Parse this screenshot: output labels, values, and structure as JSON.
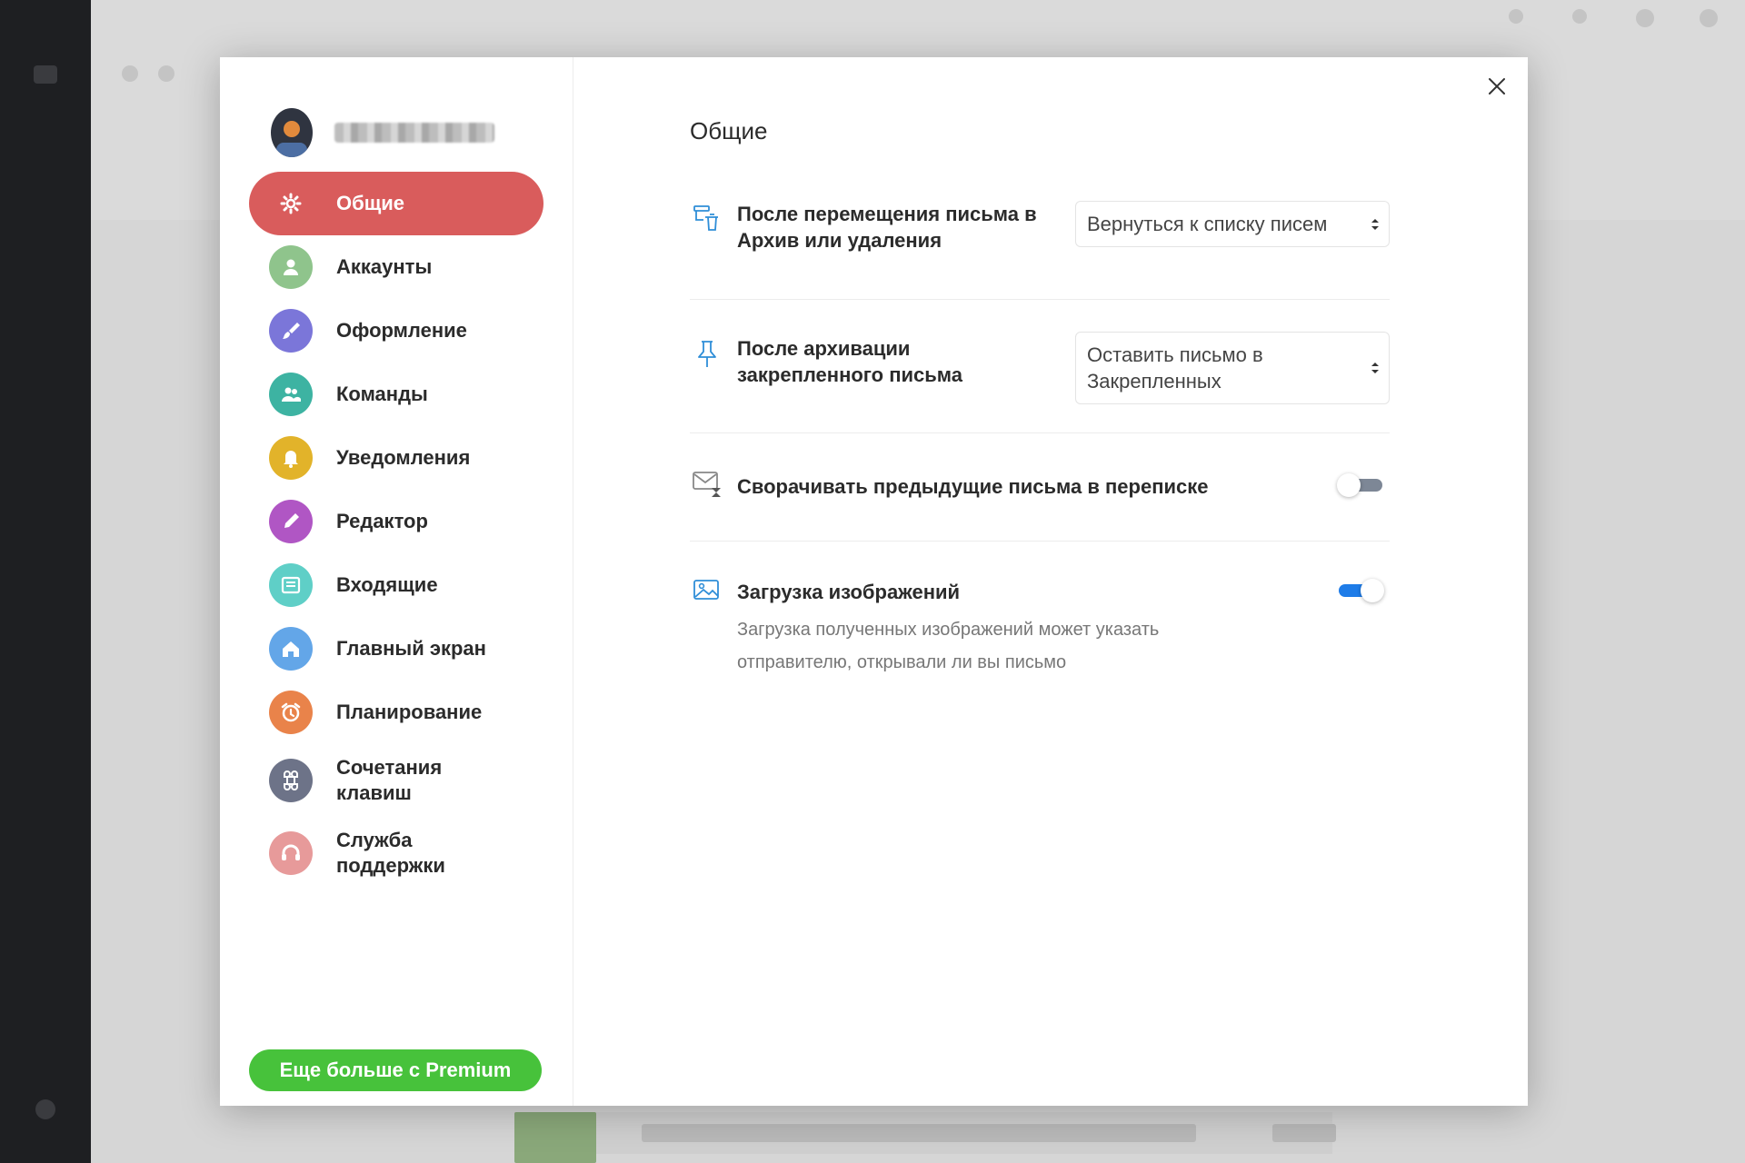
{
  "sidebar": {
    "items": [
      {
        "label": "Общие",
        "icon": "gear-icon",
        "color": "#d95c5c",
        "active": true
      },
      {
        "label": "Аккаунты",
        "icon": "user-icon",
        "color": "#8fc48c"
      },
      {
        "label": "Оформление",
        "icon": "brush-icon",
        "color": "#7b76d9"
      },
      {
        "label": "Команды",
        "icon": "team-icon",
        "color": "#3db3a2"
      },
      {
        "label": "Уведомления",
        "icon": "bell-icon",
        "color": "#e2b32a"
      },
      {
        "label": "Редактор",
        "icon": "pen-icon",
        "color": "#b056c4"
      },
      {
        "label": "Входящие",
        "icon": "inbox-icon",
        "color": "#5fcfc7"
      },
      {
        "label": "Главный экран",
        "icon": "home-icon",
        "color": "#63a6e8"
      },
      {
        "label": "Планирование",
        "icon": "alarm-icon",
        "color": "#e9834a"
      },
      {
        "label": "Сочетания клавиш",
        "icon": "command-key-icon",
        "color": "#6d7388"
      },
      {
        "label": "Служба поддержки",
        "icon": "headset-icon",
        "color": "#e79a9a"
      }
    ],
    "premium_label": "Еще больше с Premium"
  },
  "content": {
    "title": "Общие",
    "settings": {
      "after_move": {
        "title": "После перемещения письма в Архив или удаления",
        "value": "Вернуться к списку писем"
      },
      "after_archive_pinned": {
        "title": "После архивации закрепленного письма",
        "value": "Оставить письмо в Закрепленных"
      },
      "collapse_previous": {
        "title": "Сворачивать предыдущие письма в переписке",
        "enabled": false
      },
      "load_images": {
        "title": "Загрузка изображений",
        "description": "Загрузка полученных изображений может указать отправителю, открывали ли вы письмо",
        "enabled": true
      }
    }
  },
  "colors": {
    "accent_active": "#d95c5c",
    "premium": "#47c23b",
    "toggle_on": "#1e7ce8",
    "icon_blue": "#2f8ed8"
  }
}
